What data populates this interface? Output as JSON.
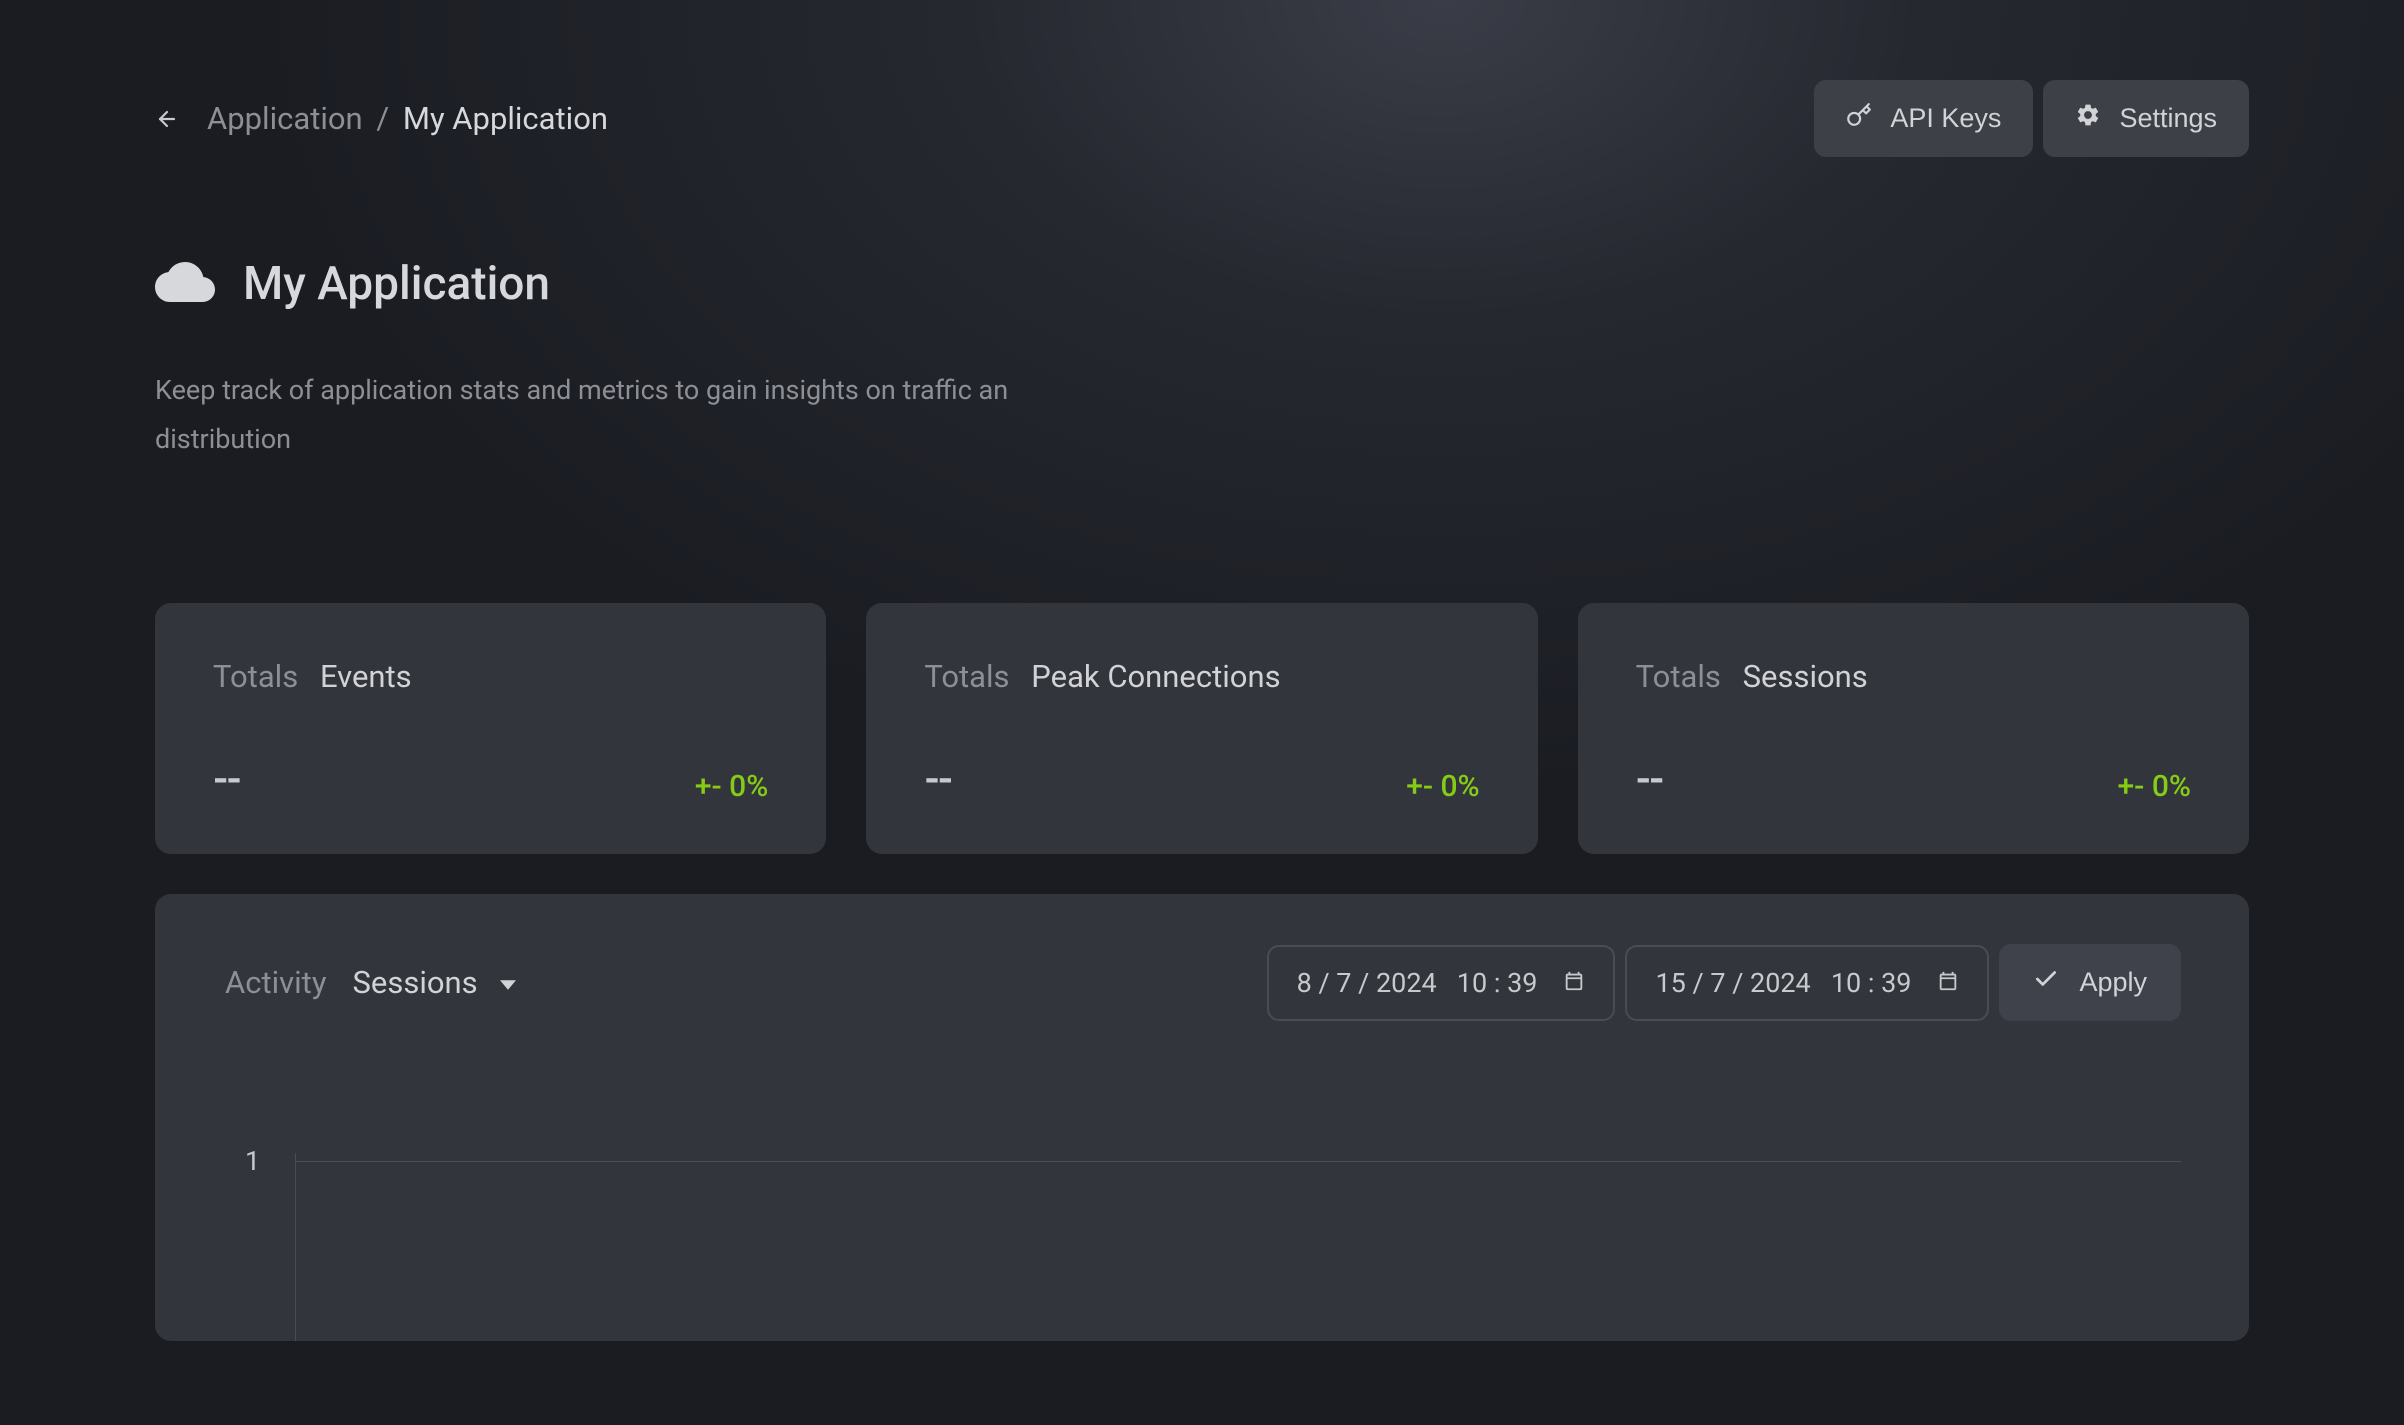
{
  "breadcrumb": {
    "parent": "Application",
    "current": "My Application"
  },
  "buttons": {
    "api_keys": "API Keys",
    "settings": "Settings",
    "apply": "Apply"
  },
  "page": {
    "title": "My Application",
    "subtitle": "Keep track of application stats and metrics to gain insights on traffic an distribution"
  },
  "totals_label": "Totals",
  "cards": [
    {
      "name": "Events",
      "value": "--",
      "delta": "+- 0%"
    },
    {
      "name": "Peak Connections",
      "value": "--",
      "delta": "+- 0%"
    },
    {
      "name": "Sessions",
      "value": "--",
      "delta": "+- 0%"
    }
  ],
  "activity": {
    "label": "Activity",
    "selected_metric": "Sessions",
    "date_from": "8 / 7 / 2024   10 : 39",
    "date_to": "15 / 7 / 2024   10 : 39"
  },
  "chart_data": {
    "type": "line",
    "title": "",
    "xlabel": "",
    "ylabel": "",
    "y_ticks": [
      1
    ],
    "series": [
      {
        "name": "Sessions",
        "values": []
      }
    ]
  }
}
